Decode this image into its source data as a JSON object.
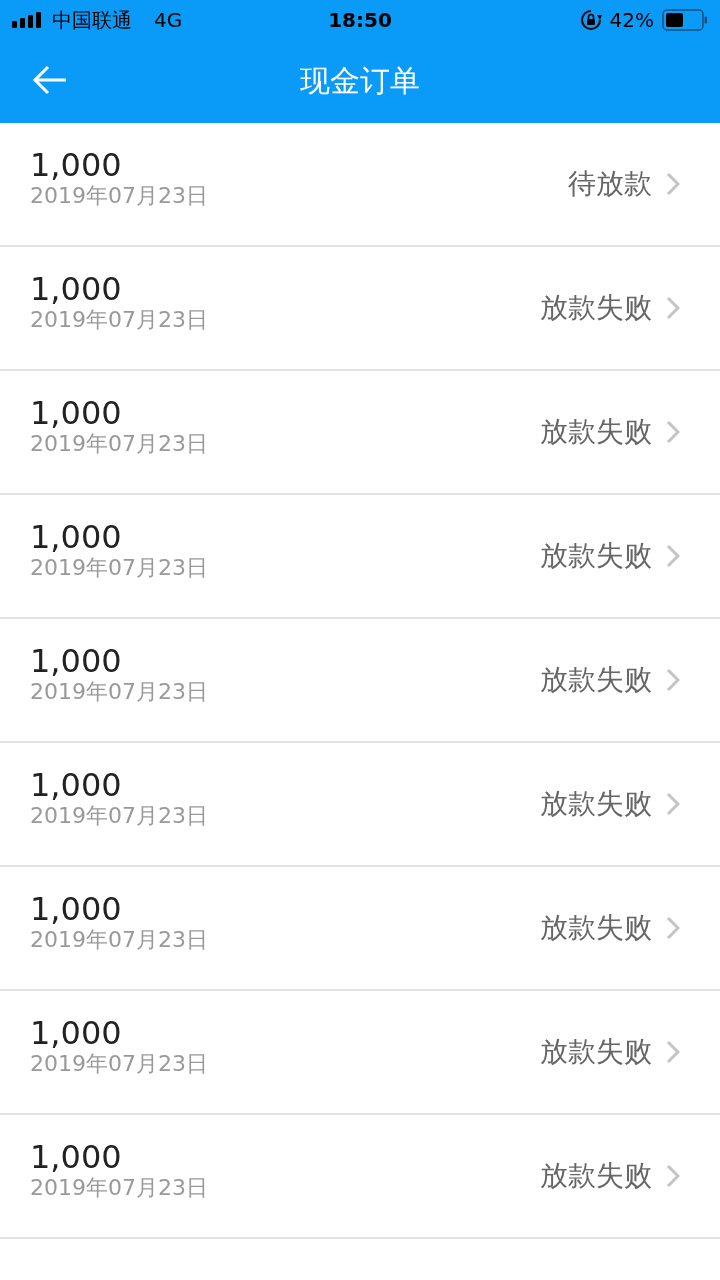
{
  "status_bar": {
    "carrier": "中国联通",
    "network": "4G",
    "time": "18:50",
    "battery": "42%"
  },
  "nav_bar": {
    "title": "现金订单"
  },
  "orders": [
    {
      "amount": "1,000",
      "date": "2019年07月23日",
      "status": "待放款"
    },
    {
      "amount": "1,000",
      "date": "2019年07月23日",
      "status": "放款失败"
    },
    {
      "amount": "1,000",
      "date": "2019年07月23日",
      "status": "放款失败"
    },
    {
      "amount": "1,000",
      "date": "2019年07月23日",
      "status": "放款失败"
    },
    {
      "amount": "1,000",
      "date": "2019年07月23日",
      "status": "放款失败"
    },
    {
      "amount": "1,000",
      "date": "2019年07月23日",
      "status": "放款失败"
    },
    {
      "amount": "1,000",
      "date": "2019年07月23日",
      "status": "放款失败"
    },
    {
      "amount": "1,000",
      "date": "2019年07月23日",
      "status": "放款失败"
    },
    {
      "amount": "1,000",
      "date": "2019年07月23日",
      "status": "放款失败"
    }
  ]
}
